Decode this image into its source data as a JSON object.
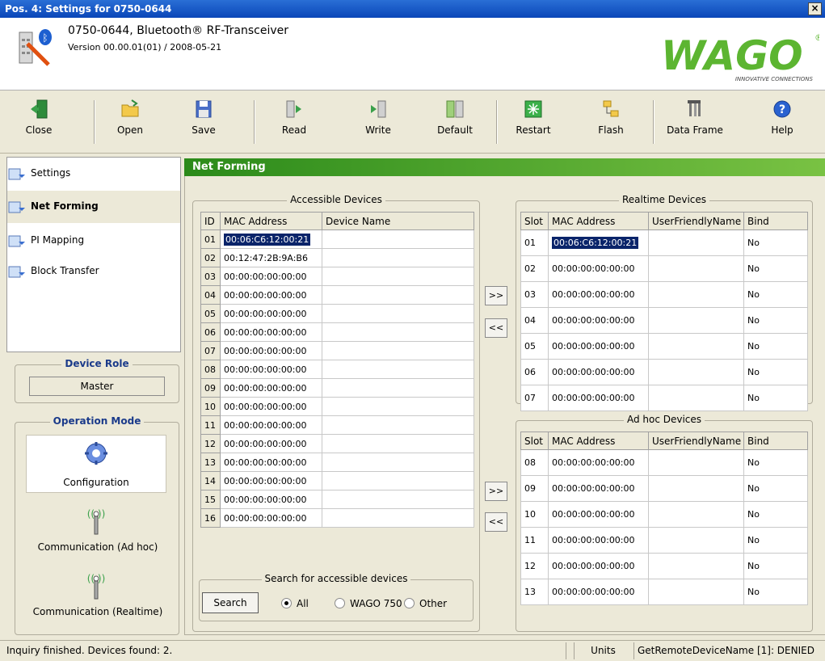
{
  "window": {
    "title": "Pos. 4: Settings for 0750-0644",
    "close_label": "×"
  },
  "header": {
    "device_title": "0750-0644, Bluetooth® RF-Transceiver",
    "version": "Version 00.00.01(01) / 2008-05-21",
    "logo_text": "WAGO",
    "logo_tagline": "INNOVATIVE CONNECTIONS",
    "logo_registered": "®"
  },
  "toolbar": {
    "close": "Close",
    "open": "Open",
    "save": "Save",
    "read": "Read",
    "write": "Write",
    "default": "Default",
    "restart": "Restart",
    "flash": "Flash",
    "data_frame": "Data Frame",
    "help": "Help"
  },
  "nav": {
    "items": [
      "Settings",
      "Net Forming",
      "PI Mapping",
      "Block Transfer"
    ]
  },
  "device_role": {
    "title": "Device Role",
    "value": "Master"
  },
  "operation_mode": {
    "title": "Operation Mode",
    "configuration": "Configuration",
    "comm_adhoc": "Communication (Ad hoc)",
    "comm_realtime": "Communication (Realtime)"
  },
  "main": {
    "section_title": "Net Forming"
  },
  "accessible": {
    "title": "Accessible Devices",
    "headers": [
      "ID",
      "MAC Address",
      "Device Name"
    ],
    "rows": [
      [
        "01",
        "00:06:C6:12:00:21",
        ""
      ],
      [
        "02",
        "00:12:47:2B:9A:B6",
        ""
      ],
      [
        "03",
        "00:00:00:00:00:00",
        ""
      ],
      [
        "04",
        "00:00:00:00:00:00",
        ""
      ],
      [
        "05",
        "00:00:00:00:00:00",
        ""
      ],
      [
        "06",
        "00:00:00:00:00:00",
        ""
      ],
      [
        "07",
        "00:00:00:00:00:00",
        ""
      ],
      [
        "08",
        "00:00:00:00:00:00",
        ""
      ],
      [
        "09",
        "00:00:00:00:00:00",
        ""
      ],
      [
        "10",
        "00:00:00:00:00:00",
        ""
      ],
      [
        "11",
        "00:00:00:00:00:00",
        ""
      ],
      [
        "12",
        "00:00:00:00:00:00",
        ""
      ],
      [
        "13",
        "00:00:00:00:00:00",
        ""
      ],
      [
        "14",
        "00:00:00:00:00:00",
        ""
      ],
      [
        "15",
        "00:00:00:00:00:00",
        ""
      ],
      [
        "16",
        "00:00:00:00:00:00",
        ""
      ]
    ]
  },
  "realtime": {
    "title": "Realtime Devices",
    "headers": [
      "Slot",
      "MAC Address",
      "UserFriendlyName",
      "Bind"
    ],
    "rows": [
      [
        "01",
        "00:06:C6:12:00:21",
        "",
        "No"
      ],
      [
        "02",
        "00:00:00:00:00:00",
        "",
        "No"
      ],
      [
        "03",
        "00:00:00:00:00:00",
        "",
        "No"
      ],
      [
        "04",
        "00:00:00:00:00:00",
        "",
        "No"
      ],
      [
        "05",
        "00:00:00:00:00:00",
        "",
        "No"
      ],
      [
        "06",
        "00:00:00:00:00:00",
        "",
        "No"
      ],
      [
        "07",
        "00:00:00:00:00:00",
        "",
        "No"
      ]
    ]
  },
  "adhoc": {
    "title": "Ad hoc Devices",
    "headers": [
      "Slot",
      "MAC Address",
      "UserFriendlyName",
      "Bind"
    ],
    "rows": [
      [
        "08",
        "00:00:00:00:00:00",
        "",
        "No"
      ],
      [
        "09",
        "00:00:00:00:00:00",
        "",
        "No"
      ],
      [
        "10",
        "00:00:00:00:00:00",
        "",
        "No"
      ],
      [
        "11",
        "00:00:00:00:00:00",
        "",
        "No"
      ],
      [
        "12",
        "00:00:00:00:00:00",
        "",
        "No"
      ],
      [
        "13",
        "00:00:00:00:00:00",
        "",
        "No"
      ]
    ]
  },
  "transfer": {
    "add": ">>",
    "remove": "<<"
  },
  "search": {
    "title": "Search for accessible devices",
    "button": "Search",
    "options": [
      "All",
      "WAGO 750",
      "Other"
    ],
    "selected": "All"
  },
  "status": {
    "message": "Inquiry finished. Devices found: 2.",
    "units": "Units",
    "right": "GetRemoteDeviceName [1]: DENIED"
  },
  "colors": {
    "titlebar": "#0a46b8",
    "accent_green": "#79c243",
    "selection": "#0a246a",
    "logo_green": "#5cb531"
  }
}
